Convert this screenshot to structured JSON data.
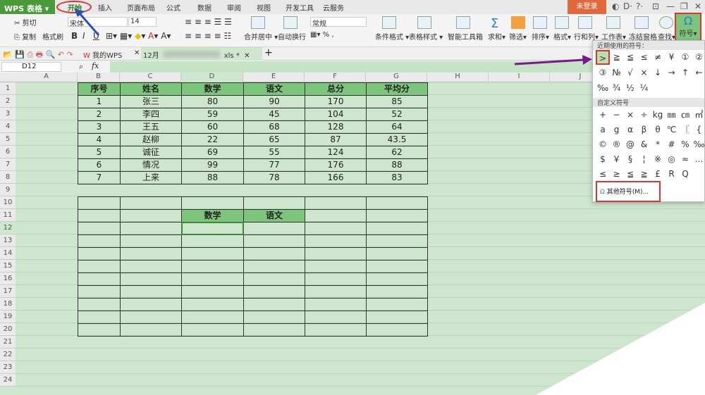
{
  "app": {
    "logo": "WPS 表格",
    "login": "未登录",
    "controls": [
      "◐",
      "D·",
      "?·",
      "⊡",
      "—",
      "❐",
      "✕"
    ]
  },
  "tabs": [
    "开始",
    "插入",
    "页面布局",
    "公式",
    "数据",
    "审阅",
    "视图",
    "开发工具",
    "云服务"
  ],
  "ribbon": {
    "cut": "剪切",
    "copy": "复制",
    "format_painter": "格式刷",
    "font": "宋体",
    "size": "14",
    "number_format": "常规",
    "merge": "合并居中",
    "wrap": "自动换行",
    "cond_format": "条件格式",
    "table_style": "表格样式",
    "smart_toolbox": "智能工具箱",
    "sum": "求和",
    "filter": "筛选",
    "sort": "排序",
    "format": "格式",
    "row_col": "行和列",
    "sheet": "工作表",
    "freeze": "冻结窗格",
    "find": "查找",
    "symbol": "符号",
    "bold": "B",
    "italic": "I",
    "underline": "U"
  },
  "doc_tabs": [
    {
      "label": "我的WPS"
    },
    {
      "label": "12月",
      "suffix": "xls *"
    }
  ],
  "formula_bar": {
    "cell_ref": "D12",
    "fx": "fx",
    "value": ""
  },
  "columns": [
    "A",
    "B",
    "C",
    "D",
    "E",
    "F",
    "G",
    "H",
    "I",
    "J"
  ],
  "rows": [
    "1",
    "2",
    "3",
    "4",
    "5",
    "6",
    "7",
    "8",
    "9",
    "10",
    "11",
    "12",
    "13",
    "14",
    "15",
    "16",
    "17",
    "18",
    "19",
    "20",
    "21",
    "22",
    "23",
    "24"
  ],
  "table1": {
    "headers": [
      "序号",
      "姓名",
      "数学",
      "语文",
      "总分",
      "平均分"
    ],
    "rows": [
      [
        "1",
        "张三",
        "80",
        "90",
        "170",
        "85"
      ],
      [
        "2",
        "李四",
        "59",
        "45",
        "104",
        "52"
      ],
      [
        "3",
        "王五",
        "60",
        "68",
        "128",
        "64"
      ],
      [
        "4",
        "赵柳",
        "22",
        "65",
        "87",
        "43.5"
      ],
      [
        "5",
        "诚征",
        "69",
        "55",
        "124",
        "62"
      ],
      [
        "6",
        "情况",
        "99",
        "77",
        "176",
        "88"
      ],
      [
        "7",
        "上来",
        "88",
        "78",
        "166",
        "83"
      ]
    ]
  },
  "table2": {
    "headers": [
      "",
      "",
      "数学",
      "语文",
      "",
      ""
    ]
  },
  "symbol_panel": {
    "recent_title": "近期使用的符号：",
    "recent": [
      ">",
      "≧",
      "≦",
      "≤",
      "≠",
      "¥",
      "①",
      "②",
      "③",
      "№",
      "√",
      "×",
      "↓",
      "→",
      "↑",
      "←",
      "‰",
      "¾",
      "½",
      "¼"
    ],
    "custom_title": "自定义符号",
    "custom": [
      "+",
      "−",
      "×",
      "÷",
      "kg",
      "㎜",
      "㎝",
      "㎡",
      "a",
      "g",
      "α",
      "β",
      "θ",
      "℃",
      "〖",
      "{",
      "©",
      "®",
      "@",
      "&",
      "*",
      "#",
      "%",
      "‰",
      "$",
      "￥",
      "§",
      "¦",
      "※",
      "◎",
      "≈",
      "…",
      "≤",
      "≥",
      "≦",
      "≧",
      "£",
      "R",
      "Q"
    ],
    "more": "其他符号(M)..."
  },
  "colors": {
    "accent": "#4a9a3a",
    "header_fill": "#7dc47d",
    "sheet_bg": "#cde6cd",
    "highlight": "#d33"
  }
}
